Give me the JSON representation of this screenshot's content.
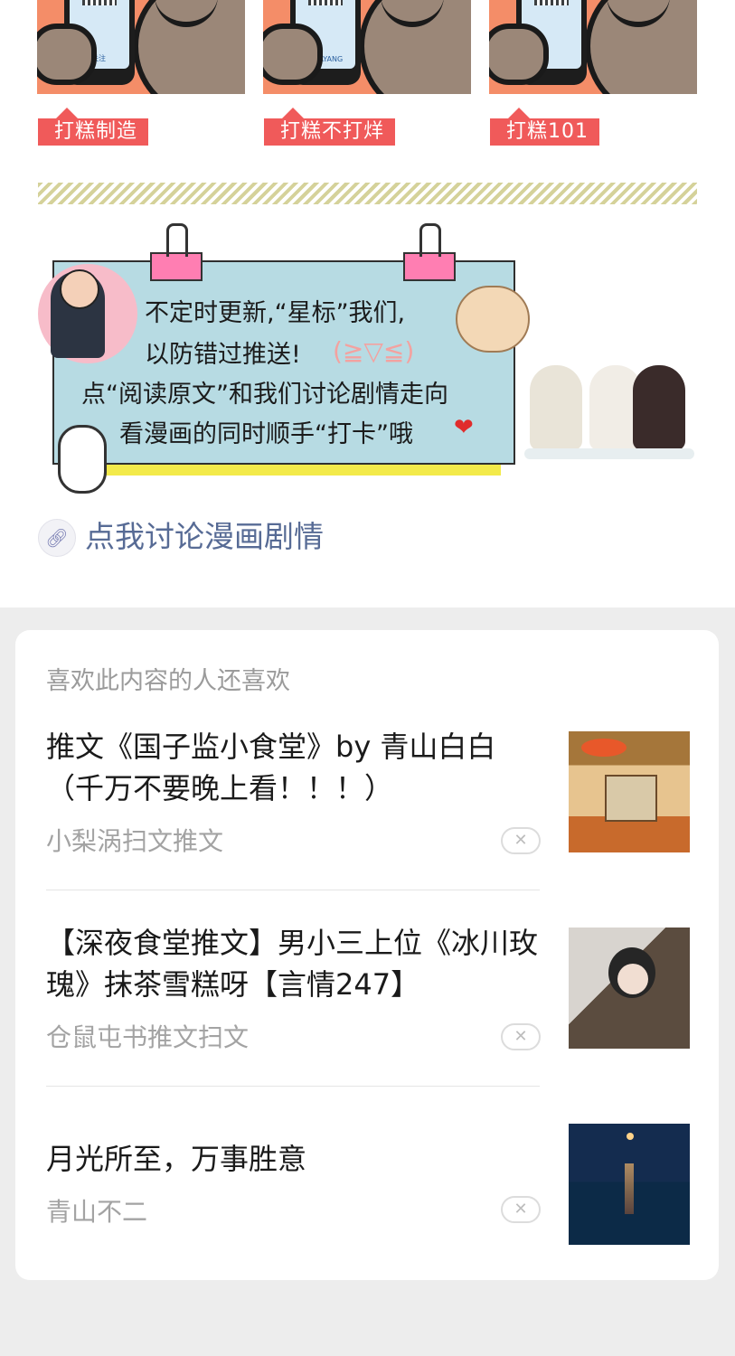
{
  "promo": {
    "tags": [
      "打糕制造",
      "打糕不打烊",
      "打糕101"
    ],
    "phone_labels": [
      "打糕关注",
      "BUDAYANG",
      "101"
    ]
  },
  "notice": {
    "lines": [
      "不定时更新,“星标”我们,",
      "以防错过推送!",
      "点“阅读原文”和我们讨论剧情走向",
      "看漫画的同时顺手“打卡”哦"
    ],
    "kaomoji": "(≧▽≦)",
    "heart": "❤"
  },
  "discuss_link": {
    "icon": "link-icon",
    "label": "点我讨论漫画剧情"
  },
  "recommend": {
    "title": "喜欢此内容的人还喜欢",
    "dismiss_glyph": "✕",
    "items": [
      {
        "title": "推文《国子监小食堂》by 青山白白（千万不要晚上看！！！）",
        "source": "小梨涡扫文推文"
      },
      {
        "title": "【深夜食堂推文】男小三上位《冰川玫瑰》抹茶雪糕呀【言情247】",
        "source": "仓鼠屯书推文扫文"
      },
      {
        "title": "月光所至，万事胜意",
        "source": "青山不二"
      }
    ]
  },
  "colors": {
    "link": "#576b95",
    "tag_bg": "#f05a5a",
    "board_bg": "#b7dbe3",
    "page_bg": "#ededed"
  }
}
